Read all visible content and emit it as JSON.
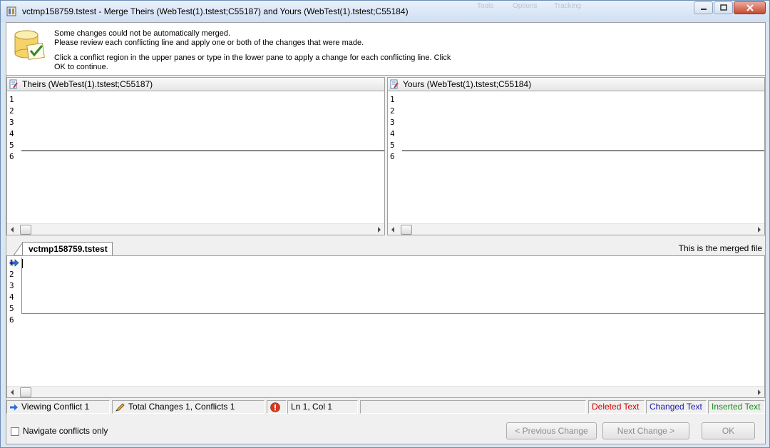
{
  "window": {
    "title": "vctmp158759.tstest - Merge Theirs (WebTest(1).tstest;C55187) and Yours (WebTest(1).tstest;C55184)",
    "background_menu": [
      "Tools",
      "Options",
      "Tracking"
    ]
  },
  "info": {
    "line1": "Some changes could not be automatically merged.",
    "line2": "Please review each conflicting line and apply one or both of the changes that were made.",
    "line3": "Click a conflict region in the upper panes or type in the lower pane to apply a change for each conflicting line. Click OK to continue."
  },
  "theirs": {
    "title": "Theirs (WebTest(1).tstest;C55187)",
    "line_numbers": [
      "1",
      "2",
      "3",
      "4",
      "5",
      "6"
    ]
  },
  "yours": {
    "title": "Yours (WebTest(1).tstest;C55184)",
    "line_numbers": [
      "1",
      "2",
      "3",
      "4",
      "5",
      "6"
    ]
  },
  "merged": {
    "tab_label": "vctmp158759.tstest",
    "description": "This is the merged file",
    "line_numbers": [
      "1",
      "2",
      "3",
      "4",
      "5",
      "6"
    ]
  },
  "status": {
    "viewing": "Viewing Conflict 1",
    "totals": "Total Changes 1, Conflicts 1",
    "position": "Ln 1, Col 1",
    "legend": {
      "deleted": "Deleted Text",
      "changed": "Changed Text",
      "inserted": "Inserted Text"
    },
    "colors": {
      "deleted": "#d00000",
      "changed": "#1a1aa6",
      "inserted": "#1a8a1a"
    }
  },
  "footer": {
    "navigate_label": "Navigate conflicts only",
    "navigate_checked": false,
    "prev_button": "< Previous Change",
    "next_button": "Next Change >",
    "ok_button": "OK"
  },
  "icons": [
    "app-icon",
    "database-check-icon",
    "document-edit-icon",
    "arrow-right-icon",
    "pencil-icon",
    "error-icon"
  ]
}
